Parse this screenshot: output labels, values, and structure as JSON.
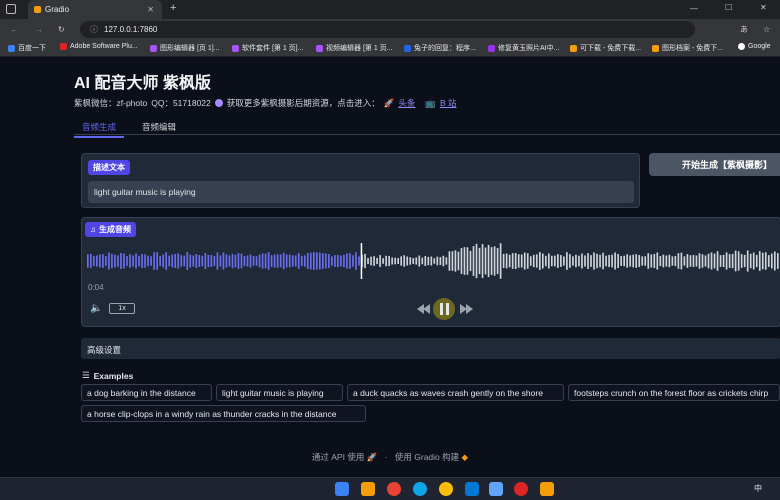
{
  "browser": {
    "tab_title": "Gradio",
    "url": "127.0.0.1:7860",
    "bookmarks": [
      "百度一下",
      "Adobe Software Plu...",
      "图形编辑器 [页 1]...",
      "软件套件 [第 1 页]...",
      "视频编辑器 [第 1 页...",
      "兔子的回复：程序...",
      "修复黄玉照片AI中...",
      "可下载 - 免费下载...",
      "图形档案 - 免费下...",
      "Google"
    ]
  },
  "app": {
    "title": "AI 配音大师 紫枫版",
    "wechat_text": "紫枫微信：zf-photo",
    "qq_text": "QQ：51718022",
    "promo_text": "获取更多紫枫摄影后期资源，点击进入：",
    "link1": "头条",
    "link2": "B 站",
    "tabs": [
      "音频生成",
      "音频编辑"
    ]
  },
  "input": {
    "label": "描述文本",
    "value": "light guitar music is playing"
  },
  "generate_button": "开始生成【紫枫摄影】",
  "audio": {
    "label": "生成音频",
    "current_time": "0:04",
    "speed": "1x",
    "progress": 0.395
  },
  "advanced_label": "高级设置",
  "examples": {
    "header": "Examples",
    "items": [
      "a dog barking in the distance",
      "light guitar music is playing",
      "a duck quacks as waves crash gently on the shore",
      "footsteps crunch on the forest floor as crickets chirp",
      "a horse clip-clops in a windy rain as thunder cracks in the distance"
    ]
  },
  "footer": {
    "api": "通过 API 使用",
    "built": "使用 Gradio 构建"
  },
  "taskbar": {
    "ime": "中"
  },
  "colors": {
    "accent": "#6366f1",
    "played": "#6b6ef0",
    "unplayed": "#d1d5db"
  }
}
